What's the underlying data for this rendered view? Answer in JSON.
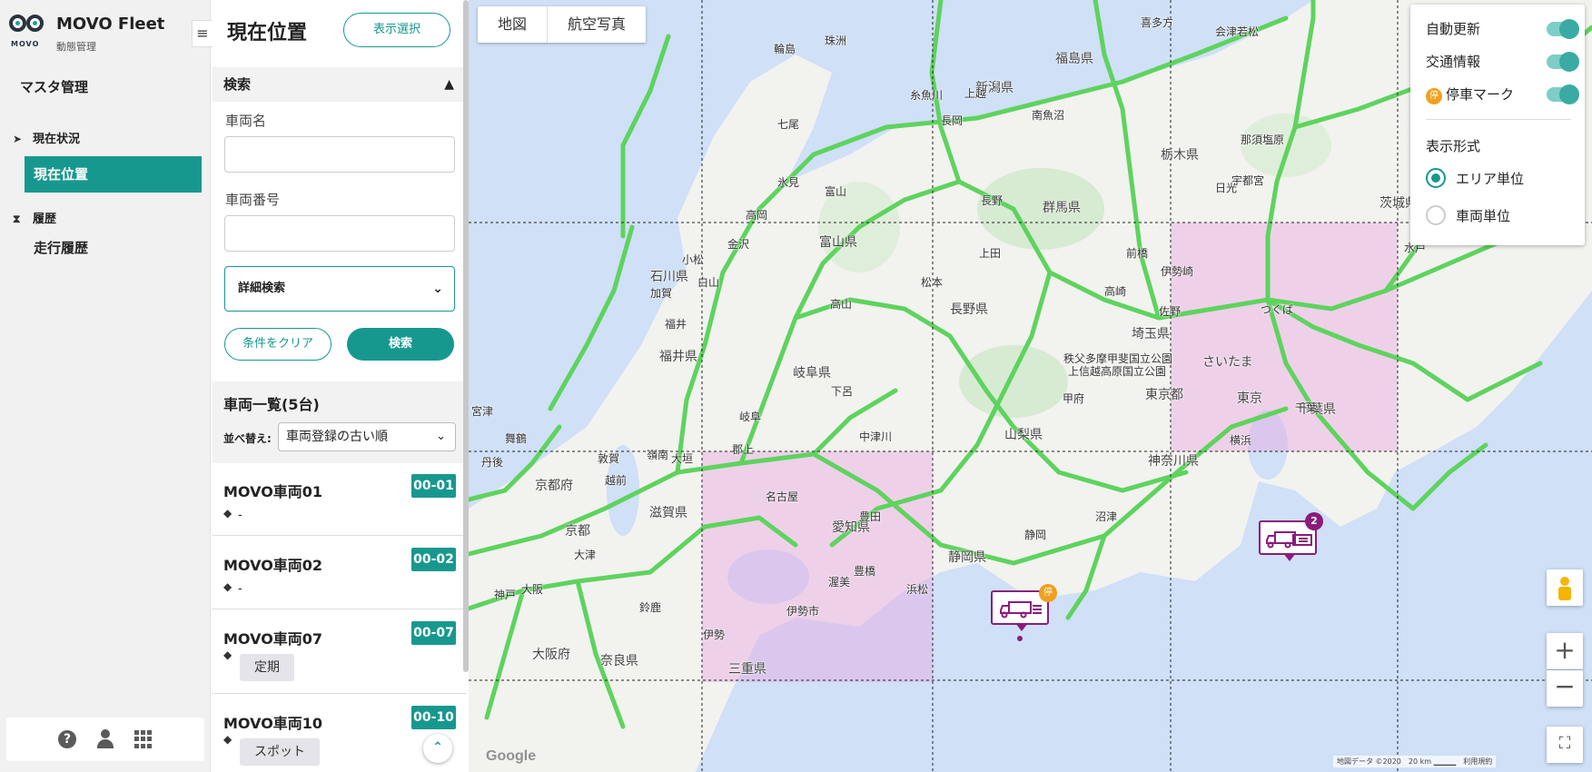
{
  "brand": {
    "name": "MOVO Fleet",
    "subtitle": "動態管理",
    "logo_text": "MOVO"
  },
  "nav": {
    "master": "マスタ管理",
    "sections": [
      {
        "icon": "navigation-arrow-icon",
        "label": "現在状況",
        "items": [
          {
            "label": "現在位置",
            "active": true
          }
        ]
      },
      {
        "icon": "hourglass-icon",
        "label": "履歴",
        "items": [
          {
            "label": "走行履歴",
            "active": false
          }
        ]
      }
    ],
    "footer_icons": [
      "help-icon",
      "user-icon",
      "apps-grid-icon"
    ]
  },
  "panel": {
    "title": "現在位置",
    "display_select_label": "表示選択",
    "search": {
      "header": "検索",
      "vehicle_name_label": "車両名",
      "vehicle_name_value": "",
      "vehicle_number_label": "車両番号",
      "vehicle_number_value": "",
      "detail_search_label": "詳細検索",
      "clear_label": "条件をクリア",
      "search_label": "検索"
    },
    "list": {
      "title": "車両一覧(5台)",
      "sort_label": "並べ替え:",
      "sort_value": "車両登録の古い順",
      "vehicles": [
        {
          "name": "MOVO車両01",
          "code": "00-01",
          "tag": "-"
        },
        {
          "name": "MOVO車両02",
          "code": "00-02",
          "tag": "-"
        },
        {
          "name": "MOVO車両07",
          "code": "00-07",
          "tag": "定期"
        },
        {
          "name": "MOVO車両10",
          "code": "00-10",
          "tag": "スポット"
        }
      ]
    }
  },
  "map": {
    "tabs": [
      "地図",
      "航空写真"
    ],
    "controls": {
      "auto_update": "自動更新",
      "traffic": "交通情報",
      "stopped_mark": "停車マーク",
      "stopped_icon_text": "停",
      "display_format_title": "表示形式",
      "area_unit": "エリア単位",
      "vehicle_unit": "車両単位",
      "selected_format": "area"
    },
    "zoom_in": "+",
    "zoom_out": "−",
    "fullscreen_icon": "fullscreen-icon",
    "footer": "地図データ ©2020　20 km ▁▁▁▁　利用規約",
    "google": "Google",
    "markers": [
      {
        "count": "2",
        "area": "埼玉・東京"
      },
      {
        "count": "2",
        "area": "名古屋"
      },
      {
        "count": "",
        "area": "大阪"
      }
    ],
    "labels": {
      "prefectures": [
        "福島県",
        "新潟県",
        "栃木県",
        "群馬県",
        "茨城県",
        "富山県",
        "石川県",
        "長野県",
        "埼玉県",
        "福井県",
        "岐阜県",
        "東京都",
        "千葉県",
        "山梨県",
        "神奈川県",
        "京都府",
        "滋賀県",
        "愛知県",
        "静岡県",
        "大阪府",
        "奈良県",
        "三重県"
      ],
      "cities": [
        "輪島",
        "珠洲",
        "七尾",
        "氷見",
        "富山",
        "高岡",
        "金沢",
        "小松",
        "加賀",
        "福井",
        "白山",
        "高山",
        "下呂",
        "中津川",
        "郡上",
        "大垣",
        "岐阜",
        "名古屋",
        "豊橋",
        "浜松",
        "静岡",
        "沼津",
        "甲府",
        "長野",
        "松本",
        "上田",
        "前橋",
        "高崎",
        "伊勢崎",
        "宇都宮",
        "日光",
        "水戸",
        "那須塩原",
        "会津若松",
        "喜多方",
        "長岡",
        "糸魚川",
        "上越",
        "南魚沼",
        "佐野",
        "つくば",
        "さいたま",
        "東京",
        "横浜",
        "千葉",
        "京都",
        "大阪",
        "神戸",
        "宮津",
        "舞鶴",
        "伊勢",
        "伊勢市",
        "渥美",
        "豊田",
        "上信越高原国立公園",
        "秩父多摩甲斐国立公園",
        "越前",
        "敦賀",
        "丹後",
        "鈴鹿",
        "嶺南",
        "大津"
      ]
    }
  },
  "colors": {
    "accent": "#17988f",
    "marker": "#8a1c7c",
    "area_fill": "#e8a8e0",
    "road": "#5ed35e",
    "water": "#cfe0f7",
    "land": "#f2f2ef"
  }
}
